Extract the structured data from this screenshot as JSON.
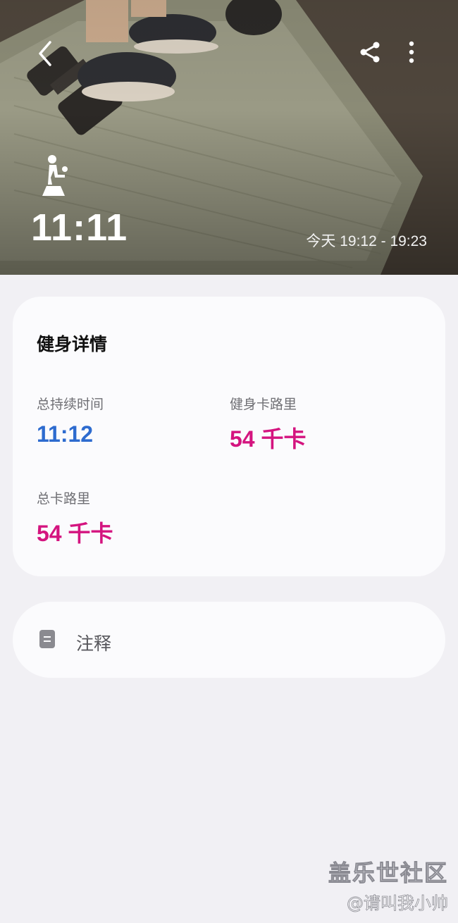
{
  "header": {
    "duration": "11:11",
    "time_range": "今天 19:12 - 19:23",
    "icons": {
      "back": "chevron-left-icon",
      "share": "share-icon",
      "more": "more-vertical-icon",
      "workout": "fitness-squat-icon"
    }
  },
  "details": {
    "title": "健身详情",
    "metrics": [
      {
        "label": "总持续时间",
        "value": "11:12",
        "color": "#2d6bcf"
      },
      {
        "label": "健身卡路里",
        "value": "54 千卡",
        "color": "#d4147f"
      },
      {
        "label": "总卡路里",
        "value": "54 千卡",
        "color": "#d4147f"
      }
    ]
  },
  "notes": {
    "label": "注释",
    "icon": "note-icon"
  },
  "watermark": {
    "line1": "盖乐世社区",
    "line2": "@请叫我小帅"
  }
}
